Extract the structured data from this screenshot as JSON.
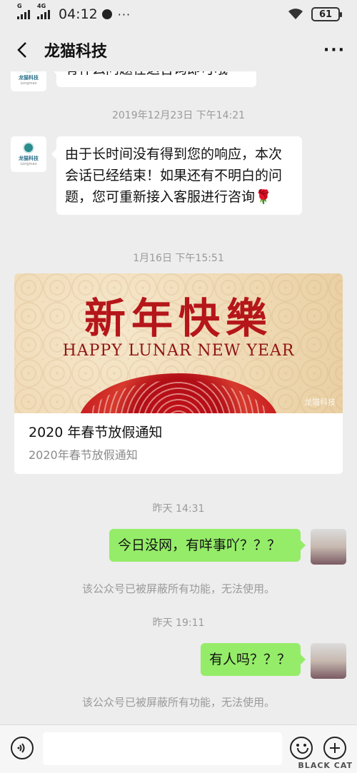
{
  "status_bar": {
    "net_label_1": "G",
    "net_label_2": "4G",
    "time": "04:12",
    "more": "···",
    "battery": "61"
  },
  "header": {
    "title": "龙猫科技"
  },
  "chat": {
    "logo_text": "龙猫科技",
    "logo_sub": "Longmao",
    "msg0": "有什么问题在这咨询即可哦",
    "ts1": "2019年12月23日 下午14:21",
    "msg1": "由于长时间没有得到您的响应，本次会话已经结束！如果还有不明白的问题，您可重新接入客服进行咨询🌹",
    "ts2": "1月16日 下午15:51",
    "card": {
      "image_text_cn": "新年快樂",
      "image_text_en": "HAPPY LUNAR NEW YEAR",
      "image_watermark": "龙猫科技",
      "title": "2020 年春节放假通知",
      "desc": "2020年春节放假通知"
    },
    "ts3": "昨天 14:31",
    "out1": "今日没网，有咩事吖？？？",
    "notice1": "该公众号已被屏蔽所有功能，无法使用。",
    "ts4": "昨天 19:11",
    "out2": "有人吗？？？",
    "notice2": "该公众号已被屏蔽所有功能，无法使用。"
  },
  "input_bar": {
    "value": "",
    "placeholder": ""
  },
  "watermark": {
    "text": "BLACK CAT"
  },
  "colors": {
    "background": "#ededed",
    "outgoing_bubble": "#95ec69",
    "incoming_bubble": "#ffffff",
    "timestamp": "#9a9a9a"
  }
}
